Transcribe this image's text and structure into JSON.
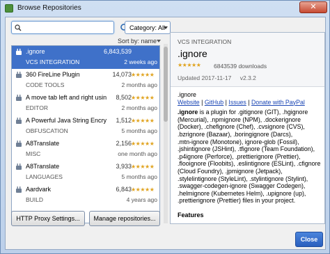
{
  "window": {
    "title": "Browse Repositories",
    "close_glyph": "✕"
  },
  "toolbar": {
    "search_placeholder": "",
    "category_label": "Category: All"
  },
  "sort_label": "Sort by: name",
  "plugins": [
    {
      "name": ".ignore",
      "downloads": "6,843,539",
      "category": "VCS INTEGRATION",
      "date": "2 weeks ago",
      "stars": "",
      "selected": true
    },
    {
      "name": "360 FireLine Plugin",
      "downloads": "14,073",
      "category": "CODE TOOLS",
      "date": "2 months ago",
      "stars": "★★★★★"
    },
    {
      "name": "A move tab left and right using",
      "downloads": "8,502",
      "category": "EDITOR",
      "date": "2 months ago",
      "stars": "★★★★★"
    },
    {
      "name": "A Powerful Java String Encrypto",
      "downloads": "1,512",
      "category": "OBFUSCATION",
      "date": "5 months ago",
      "stars": "★★★★★"
    },
    {
      "name": "A8Translate",
      "downloads": "2,156",
      "category": "MISC",
      "date": "one month ago",
      "stars": "★★★★★"
    },
    {
      "name": "A8Translate",
      "downloads": "3,933",
      "category": "LANGUAGES",
      "date": "5 months ago",
      "stars": "★★★★★"
    },
    {
      "name": "Aardvark",
      "downloads": "6,843",
      "category": "BUILD",
      "date": "4 years ago",
      "stars": "★★★★★"
    },
    {
      "name": "",
      "downloads": "",
      "category": "",
      "date": "",
      "stars": ""
    }
  ],
  "detail": {
    "category": "VCS INTEGRATION",
    "name": ".ignore",
    "stars": "★★★★★",
    "downloads": "6843539 downloads",
    "updated": "Updated 2017-11-17",
    "version": "v2.3.2",
    "plugin_name_line": ".ignore",
    "links": [
      "Website",
      "GitHub",
      "Issues",
      "Donate with PayPal"
    ],
    "link_sep": " | ",
    "desc_bold": ".ignore",
    "desc_lines": [
      " is a plugin for .gitignore (GIT), .hgignore",
      "(Mercurial), .npmignore (NPM), .dockerignore",
      "(Docker), .chefignore (Chef), .cvsignore (CVS),",
      ".bzrignore (Bazaar), .boringignore (Darcs),",
      ".mtn-ignore (Monotone), ignore-glob (Fossil),",
      ".jshintignore (JSHint), .tfignore (Team Foundation),",
      ".p4ignore (Perforce), .prettierignore (Prettier),",
      ".flooignore (Floobits), .eslintignore (ESLint), .cfignore",
      "(Cloud Foundry), .jpmignore (Jetpack),",
      ".stylelintignore (StyleLint), .stylintignore (Stylint),",
      ".swagger-codegen-ignore (Swagger Codegen),",
      ".helmignore (Kubernetes Helm), .upignore (up),",
      ".prettierignore (Prettier) files in your project."
    ],
    "features_heading": "Features"
  },
  "buttons": {
    "http_proxy": "HTTP Proxy Settings...",
    "manage_repos": "Manage repositories...",
    "close": "Close"
  },
  "colors": {
    "selection": "#3f71c9",
    "stars": "#e0a31e",
    "link": "#1c47b5"
  }
}
